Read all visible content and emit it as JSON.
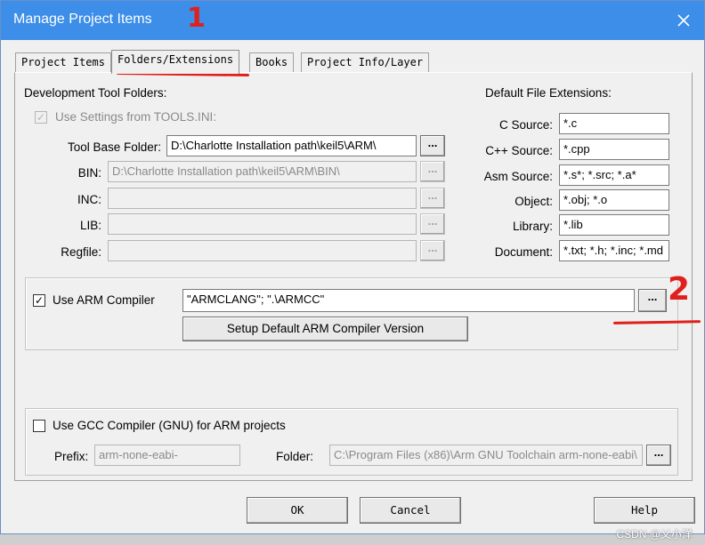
{
  "window": {
    "title": "Manage Project Items"
  },
  "tabs": [
    {
      "label": "Project Items"
    },
    {
      "label": "Folders/Extensions"
    },
    {
      "label": "Books"
    },
    {
      "label": "Project Info/Layer"
    }
  ],
  "dev_tool_folders": {
    "heading": "Development Tool Folders:",
    "use_settings_label": "Use Settings from TOOLS.INI:",
    "use_settings_checked": true,
    "tool_base_label": "Tool Base Folder:",
    "tool_base_value": "D:\\Charlotte Installation path\\keil5\\ARM\\",
    "bin_label": "BIN:",
    "bin_value": "D:\\Charlotte Installation path\\keil5\\ARM\\BIN\\",
    "inc_label": "INC:",
    "inc_value": "",
    "lib_label": "LIB:",
    "lib_value": "",
    "regfile_label": "Regfile:",
    "regfile_value": "",
    "browse_label": "..."
  },
  "extensions": {
    "heading": "Default File Extensions:",
    "items": [
      {
        "label": "C Source:",
        "value": "*.c"
      },
      {
        "label": "C++ Source:",
        "value": "*.cpp"
      },
      {
        "label": "Asm Source:",
        "value": "*.s*; *.src; *.a*"
      },
      {
        "label": "Object:",
        "value": "*.obj; *.o"
      },
      {
        "label": "Library:",
        "value": "*.lib"
      },
      {
        "label": "Document:",
        "value": "*.txt; *.h; *.inc; *.md"
      }
    ]
  },
  "arm_compiler": {
    "label": "Use ARM Compiler",
    "checked": true,
    "value": "\"ARMCLANG\"; \".\\ARMCC\"",
    "browse_label": "...",
    "setup_button": "Setup Default ARM Compiler Version"
  },
  "gcc": {
    "label": "Use GCC Compiler (GNU) for ARM projects",
    "checked": false,
    "prefix_label": "Prefix:",
    "prefix_value": "arm-none-eabi-",
    "folder_label": "Folder:",
    "folder_value": "C:\\Program Files (x86)\\Arm GNU Toolchain arm-none-eabi\\",
    "browse_label": "..."
  },
  "buttons": {
    "ok": "OK",
    "cancel": "Cancel",
    "help": "Help"
  },
  "annotations": {
    "mark1": "1",
    "mark2": "2",
    "color": "#e0201c"
  },
  "watermark": "CSDN @乂小洋"
}
